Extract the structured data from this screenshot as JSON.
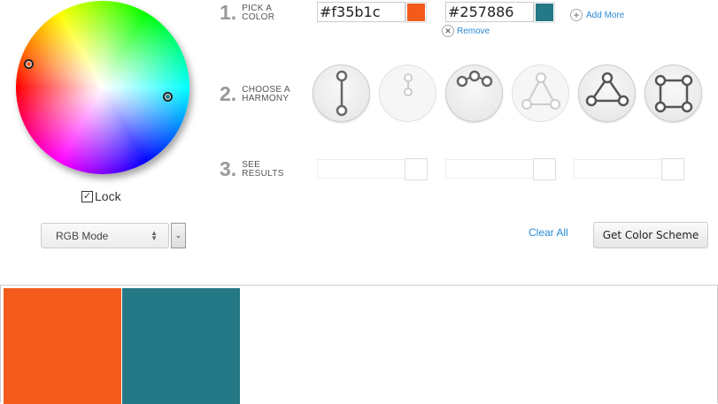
{
  "lock": {
    "label": "Lock",
    "checked": true
  },
  "mode_select": {
    "selected": "RGB Mode",
    "arrows": "▲▼",
    "dropdown_icon": "chevron-down"
  },
  "steps": [
    {
      "num": "1.",
      "line1": "PICK A",
      "line2": "COLOR"
    },
    {
      "num": "2.",
      "line1": "CHOOSE A",
      "line2": "HARMONY"
    },
    {
      "num": "3.",
      "line1": "SEE",
      "line2": "RESULTS"
    }
  ],
  "colors": [
    {
      "hex": "#f35b1c",
      "swatch": "#f35b1c"
    },
    {
      "hex": "#257886",
      "swatch": "#257886"
    }
  ],
  "add_more": "Add More",
  "remove": "Remove",
  "harmonies": [
    {
      "icon": "complementary-icon",
      "active": true
    },
    {
      "icon": "split-small-icon",
      "active": false
    },
    {
      "icon": "analogous-icon",
      "active": true
    },
    {
      "icon": "triad-dim-icon",
      "active": false
    },
    {
      "icon": "triad-icon",
      "active": true
    },
    {
      "icon": "tetrad-icon",
      "active": true
    }
  ],
  "clear_all": "Clear All",
  "get_scheme": "Get Color Scheme",
  "palette": [
    "#f35b1c",
    "#257886"
  ]
}
